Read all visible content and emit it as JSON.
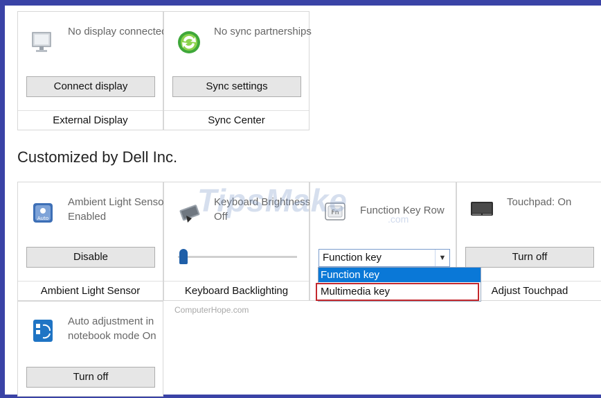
{
  "tiles": {
    "external_display": {
      "status": "No display connected",
      "button": "Connect display",
      "caption": "External Display"
    },
    "sync_center": {
      "status": "No sync partnerships",
      "button": "Sync settings",
      "caption": "Sync Center"
    },
    "ambient_light": {
      "status": "Ambient Light Sensor Enabled",
      "button": "Disable",
      "caption": "Ambient Light Sensor"
    },
    "keyboard_backlight": {
      "status": "Keyboard Brightness: Off",
      "caption": "Keyboard Backlighting",
      "slider_level": 0
    },
    "function_key_row": {
      "status": "Function Key Row",
      "selected": "Function key",
      "options": [
        "Function key",
        "Multimedia key"
      ]
    },
    "touchpad": {
      "status": "Touchpad: On",
      "button": "Turn off",
      "caption": "Adjust Touchpad"
    },
    "auto_adjust": {
      "status": "Auto adjustment in notebook mode On",
      "button": "Turn off"
    }
  },
  "section": {
    "title": "Customized by Dell Inc."
  },
  "watermark": {
    "text": "TipsMake",
    "suffix": ".com"
  },
  "credit": "ComputerHope.com",
  "colors": {
    "frame": "#3a43a6",
    "selection": "#0a78d7",
    "highlight_border": "#c3282d",
    "slider": "#1f5fa8"
  }
}
